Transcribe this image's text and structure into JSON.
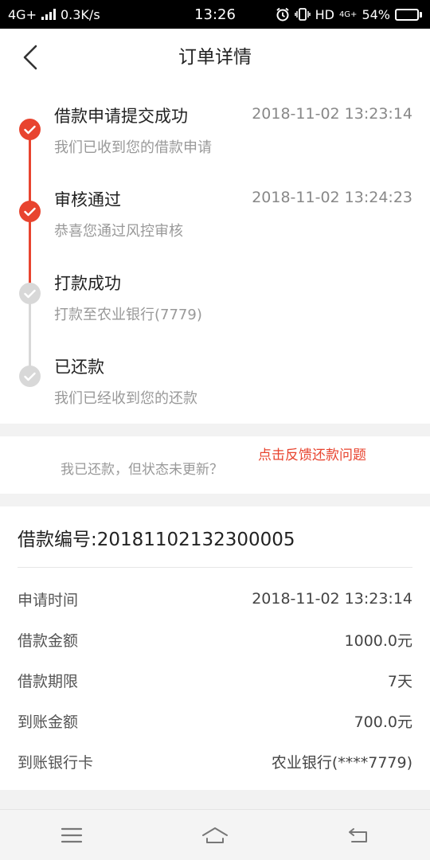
{
  "status_bar": {
    "network": "4G+",
    "speed": "0.3K/s",
    "time": "13:26",
    "hd": "HD",
    "net2": "4G+",
    "battery": "54%",
    "battery_level": 0.54
  },
  "header": {
    "title": "订单详情"
  },
  "timeline": [
    {
      "title": "借款申请提交成功",
      "time": "2018-11-02 13:23:14",
      "desc": "我们已收到您的借款申请",
      "done": true
    },
    {
      "title": "审核通过",
      "time": "2018-11-02 13:24:23",
      "desc": "恭喜您通过风控审核",
      "done": true
    },
    {
      "title": "打款成功",
      "time": "",
      "desc": "打款至农业银行(7779)",
      "done": false
    },
    {
      "title": "已还款",
      "time": "",
      "desc": "我们已经收到您的还款",
      "done": false
    }
  ],
  "feedback": {
    "text": "我已还款，但状态未更新？",
    "link": "点击反馈还款问题"
  },
  "details": {
    "loan_no": "借款编号:20181102132300005",
    "rows": [
      {
        "label": "申请时间",
        "value": "2018-11-02 13:23:14"
      },
      {
        "label": "借款金额",
        "value": "1000.0元"
      },
      {
        "label": "借款期限",
        "value": "7天"
      },
      {
        "label": "到账金额",
        "value": "700.0元"
      },
      {
        "label": "到账银行卡",
        "value": "农业银行(****7779)"
      }
    ]
  },
  "colors": {
    "accent": "#e8442f",
    "pending": "#d8d8d8"
  }
}
